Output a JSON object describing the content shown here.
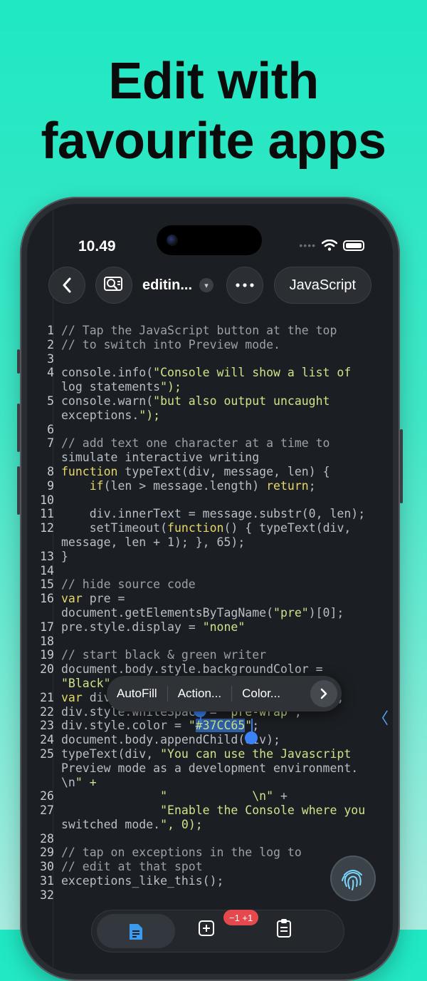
{
  "headline": {
    "line1": "Edit with",
    "line2": "favourite apps"
  },
  "status_bar": {
    "time": "10.49"
  },
  "toolbar": {
    "back_icon": "chevron-left-icon",
    "search_icon": "search-document-icon",
    "title": "editin...",
    "more_icon": "ellipsis-icon",
    "language_label": "JavaScript"
  },
  "code_lines": [
    {
      "n": "1",
      "text": "// Tap the JavaScript button at the top"
    },
    {
      "n": "2",
      "text": "// to switch into Preview mode."
    },
    {
      "n": "3",
      "text": ""
    },
    {
      "n": "4",
      "text": "console.info(\"Console will show a list of"
    },
    {
      "n": "",
      "text": "log statements\");"
    },
    {
      "n": "5",
      "text": "console.warn(\"but also output uncaught"
    },
    {
      "n": "",
      "text": "exceptions.\");"
    },
    {
      "n": "6",
      "text": ""
    },
    {
      "n": "7",
      "text": "// add text one character at a time to"
    },
    {
      "n": "",
      "text": "simulate interactive writing"
    },
    {
      "n": "8",
      "text": "function typeText(div, message, len) {"
    },
    {
      "n": "9",
      "text": "    if(len > message.length) return;"
    },
    {
      "n": "10",
      "text": ""
    },
    {
      "n": "11",
      "text": "    div.innerText = message.substr(0, len);"
    },
    {
      "n": "12",
      "text": "    setTimeout(function() { typeText(div,"
    },
    {
      "n": "",
      "text": "message, len + 1); }, 65);"
    },
    {
      "n": "13",
      "text": "}"
    },
    {
      "n": "14",
      "text": ""
    },
    {
      "n": "15",
      "text": "// hide source code"
    },
    {
      "n": "16",
      "text": "var pre ="
    },
    {
      "n": "",
      "text": "document.getElementsByTagName(\"pre\")[0];"
    },
    {
      "n": "17",
      "text": "pre.style.display = \"none\""
    },
    {
      "n": "18",
      "text": ""
    },
    {
      "n": "19",
      "text": "// start black & green writer"
    },
    {
      "n": "20",
      "text": "document.body.style.backgroundColor ="
    },
    {
      "n": "",
      "text": "\"Black\";"
    },
    {
      "n": "21",
      "text": "var div = document.createElement(\"div\");"
    },
    {
      "n": "22",
      "text": "div.style.whiteSpace = \"pre-wrap\";"
    },
    {
      "n": "23",
      "text": "div.style.color = \"#37CC65\";"
    },
    {
      "n": "24",
      "text": "document.body.appendChild(div);"
    },
    {
      "n": "25",
      "text": "typeText(div, \"You can use the Javascript"
    },
    {
      "n": "",
      "text": "Preview mode as a development environment."
    },
    {
      "n": "",
      "text": "\\n\" +"
    },
    {
      "n": "26",
      "text": "              \"            \\n\" +"
    },
    {
      "n": "27",
      "text": "              \"Enable the Console where you"
    },
    {
      "n": "",
      "text": "switched mode.\", 0);"
    },
    {
      "n": "28",
      "text": ""
    },
    {
      "n": "29",
      "text": "// tap on exceptions in the log to"
    },
    {
      "n": "30",
      "text": "// edit at that spot"
    },
    {
      "n": "31",
      "text": "exceptions_like_this();"
    },
    {
      "n": "32",
      "text": ""
    }
  ],
  "context_menu": {
    "autofill": "AutoFill",
    "action": "Action...",
    "color": "Color..."
  },
  "tabbar": {
    "badge": "−1 +1"
  },
  "fab_icon": "fingerprint-icon"
}
